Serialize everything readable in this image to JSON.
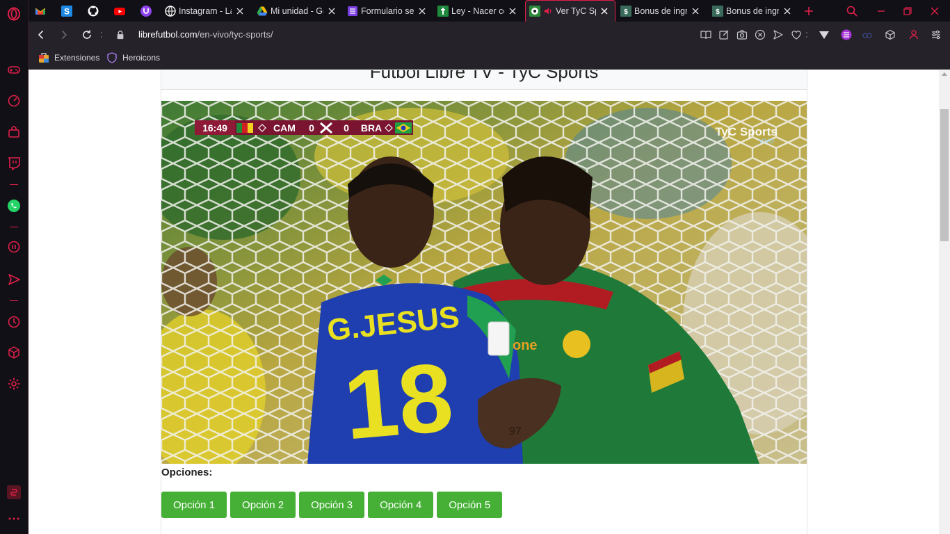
{
  "browser": {
    "tabs": [
      {
        "title": "",
        "icon": "gmail-icon"
      },
      {
        "title": "",
        "icon": "s-square-icon"
      },
      {
        "title": "",
        "icon": "github-icon"
      },
      {
        "title": "",
        "icon": "youtube-icon"
      },
      {
        "title": "",
        "icon": "u-circle-icon"
      },
      {
        "title": "Instagram - La",
        "icon": "globe-icon"
      },
      {
        "title": "Mi unidad - Go",
        "icon": "google-drive-icon"
      },
      {
        "title": "Formulario se",
        "icon": "forms-icon"
      },
      {
        "title": "Ley - Nacer co",
        "icon": "cross-flag-icon"
      },
      {
        "title": "Ver TyC Sp",
        "icon": "soccer-icon",
        "active": true,
        "audio": true
      },
      {
        "title": "Bonus de ingre",
        "icon": "bonus-icon"
      },
      {
        "title": "Bonus de ingre",
        "icon": "bonus-icon"
      }
    ],
    "address": {
      "host": "librefutbol.com",
      "path": "/en-vivo/tyc-sports/"
    },
    "bookmarks": [
      {
        "label": "Extensiones",
        "icon": "extensions-icon"
      },
      {
        "label": "Heroicons",
        "icon": "shield-icon"
      }
    ]
  },
  "page": {
    "title": "Futbol Libre TV - TyC Sports",
    "options_label": "Opciones:",
    "options": [
      "Opción 1",
      "Opción 2",
      "Opción 3",
      "Opción 4",
      "Opción 5"
    ],
    "video": {
      "scorebug": {
        "time": "16:49",
        "home": "CAM",
        "home_score": "0",
        "away_score": "0",
        "away": "BRA"
      },
      "broadcaster": "TyC Sports",
      "broadcaster_sub": "VIVO",
      "player_name": "G.JESUS",
      "player_number": "18",
      "sponsor": "one",
      "arm_number": "97"
    }
  },
  "colors": {
    "accent": "#e0204a",
    "button": "#45b035",
    "chrome_bg": "#111016"
  }
}
